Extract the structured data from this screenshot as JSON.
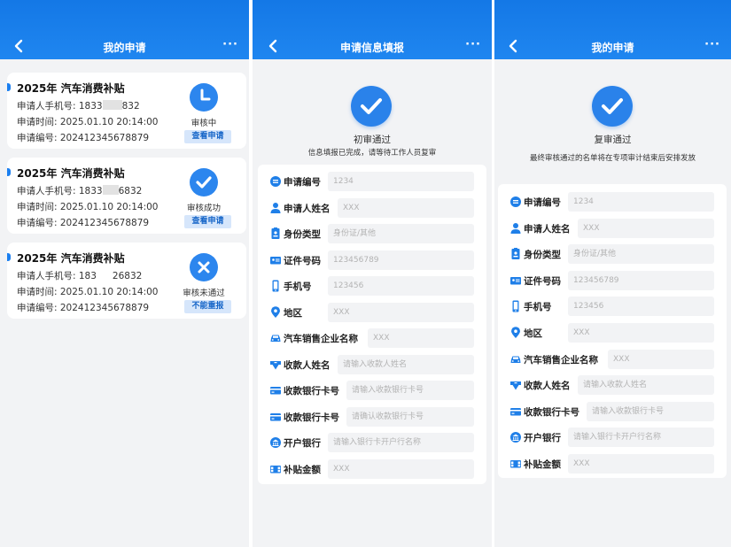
{
  "colors": {
    "primary": "#1f86f0",
    "background": "#f2f3f5",
    "badge_bg": "#d6e6fb"
  },
  "screen1": {
    "title": "我的申请",
    "more": "···",
    "cards": [
      {
        "title": "2025年 汽车消费补贴",
        "phone_a": "申请人手机号: 1833",
        "phone_b": "832",
        "time": "申请时间: 2025.01.10 20:14:00",
        "code": "申请编号: 202412345678879",
        "status": "审核中",
        "action": "查看申请",
        "icon": "clock-icon"
      },
      {
        "title": "2025年 汽车消费补贴",
        "phone_a": "申请人手机号: 1833",
        "phone_b": "6832",
        "time": "申请时间: 2025.01.10 20:14:00",
        "code": "申请编号: 202412345678879",
        "status": "审核成功",
        "action": "查看申请",
        "icon": "check-icon"
      },
      {
        "title": "2025年 汽车消费补贴",
        "phone_a": "申请人手机号: 183",
        "phone_b": "26832",
        "time": "申请时间: 2025.01.10 20:14:00",
        "code": "申请编号: 202412345678879",
        "status": "审核未通过",
        "action": "不能重报",
        "icon": "x-icon"
      }
    ]
  },
  "screen2": {
    "title": "申请信息填报",
    "more": "···",
    "stage_title": "初审通过",
    "stage_sub": "信息填报已完成，请等待工作人员复审",
    "fields": [
      {
        "label": "申请编号",
        "value": "1234",
        "icon": "id-circle-icon"
      },
      {
        "label": "申请人姓名",
        "value": "XXX",
        "icon": "person-icon"
      },
      {
        "label": "身份类型",
        "value": "身份证/其他",
        "icon": "badge-icon"
      },
      {
        "label": "证件号码",
        "value": "123456789",
        "icon": "card-icon"
      },
      {
        "label": "手机号",
        "value": "123456",
        "icon": "phone-icon"
      },
      {
        "label": "地区",
        "value": "XXX",
        "icon": "location-icon"
      },
      {
        "label": "汽车销售企业名称",
        "value": "XXX",
        "icon": "car-icon"
      },
      {
        "label": "收款人姓名",
        "value": "请输入收款人姓名",
        "icon": "receive-icon"
      },
      {
        "label": "收款银行卡号",
        "value": "请输入收款银行卡号",
        "icon": "bankcard-icon"
      },
      {
        "label": "收款银行卡号",
        "value": "请确认收款银行卡号",
        "icon": "bankcard-icon"
      },
      {
        "label": "开户银行",
        "value": "请输入银行卡开户行名称",
        "icon": "bank-icon"
      },
      {
        "label": "补贴金额",
        "value": "XXX",
        "icon": "money-icon"
      }
    ]
  },
  "screen3": {
    "title": "我的申请",
    "more": "···",
    "stage_title": "复审通过",
    "stage_sub": "最终审核通过的名单将在专项审计结束后安排发放",
    "fields": [
      {
        "label": "申请编号",
        "value": "1234",
        "icon": "id-circle-icon"
      },
      {
        "label": "申请人姓名",
        "value": "XXX",
        "icon": "person-icon"
      },
      {
        "label": "身份类型",
        "value": "身份证/其他",
        "icon": "badge-icon"
      },
      {
        "label": "证件号码",
        "value": "123456789",
        "icon": "card-icon"
      },
      {
        "label": "手机号",
        "value": "123456",
        "icon": "phone-icon"
      },
      {
        "label": "地区",
        "value": "XXX",
        "icon": "location-icon"
      },
      {
        "label": "汽车销售企业名称",
        "value": "XXX",
        "icon": "car-icon"
      },
      {
        "label": "收款人姓名",
        "value": "请输入收款人姓名",
        "icon": "receive-icon"
      },
      {
        "label": "收款银行卡号",
        "value": "请输入收款银行卡号",
        "icon": "bankcard-icon"
      },
      {
        "label": "开户银行",
        "value": "请输入银行卡开户行名称",
        "icon": "bank-icon"
      },
      {
        "label": "补贴金额",
        "value": "XXX",
        "icon": "money-icon"
      }
    ]
  }
}
